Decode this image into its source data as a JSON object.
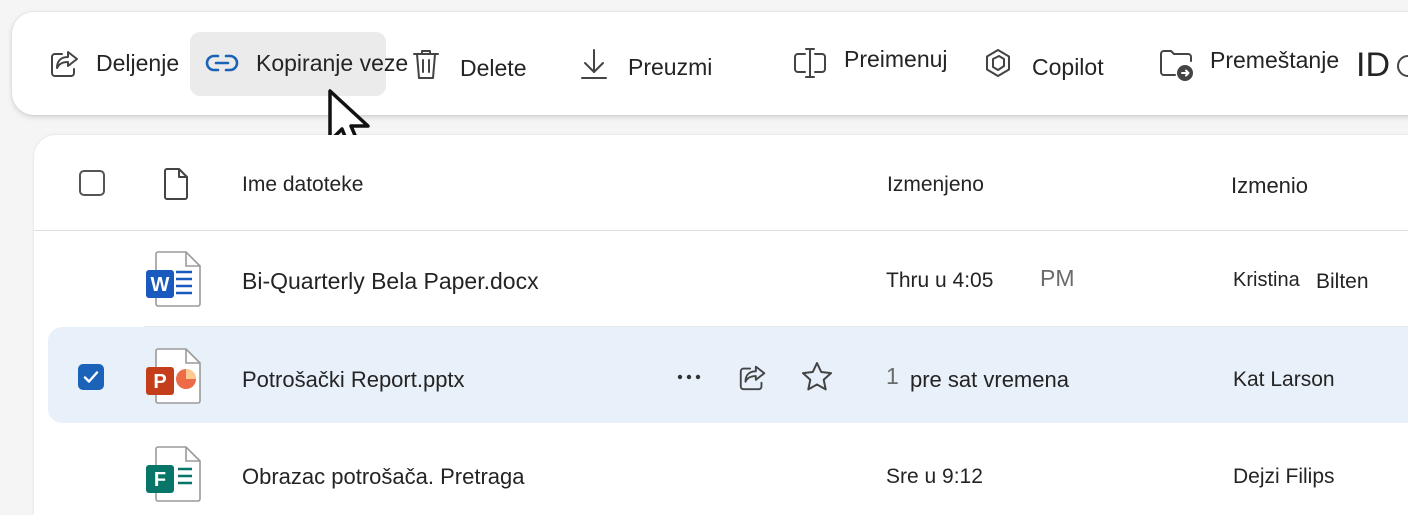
{
  "toolbar": {
    "share": "Deljenje",
    "copy_link": "Kopiranje veze",
    "delete": "Delete",
    "download": "Preuzmi",
    "rename": "Preimenuj",
    "copilot": "Copilot",
    "move": "Premeštanje",
    "id": "ID"
  },
  "table": {
    "headers": {
      "name": "Ime datoteke",
      "modified": "Izmenjeno",
      "modified_by": "Izmenio"
    },
    "rows": [
      {
        "name": "Bi-Quarterly Bela Paper.docx",
        "type": "word",
        "icon_letter": "W",
        "modified": "Thru u 4:05",
        "modified_suffix": "PM",
        "by_first": "Kristina",
        "by_last": "Bilten",
        "selected": false
      },
      {
        "name": "Potrošački Report.pptx",
        "type": "powerpoint",
        "icon_letter": "P",
        "modified_prefix": "1",
        "modified": "pre sat vremena",
        "by": "Kat Larson",
        "selected": true
      },
      {
        "name": "Obrazac potrošača. Pretraga",
        "type": "forms",
        "icon_letter": "F",
        "modified": "Sre u 9:12",
        "by": "Dejzi Filips",
        "selected": false
      }
    ]
  },
  "colors": {
    "word": "#185abd",
    "powerpoint": "#c43e1c",
    "forms": "#077568",
    "accent": "#1b63b8",
    "selected_row": "#e8f0fa"
  }
}
